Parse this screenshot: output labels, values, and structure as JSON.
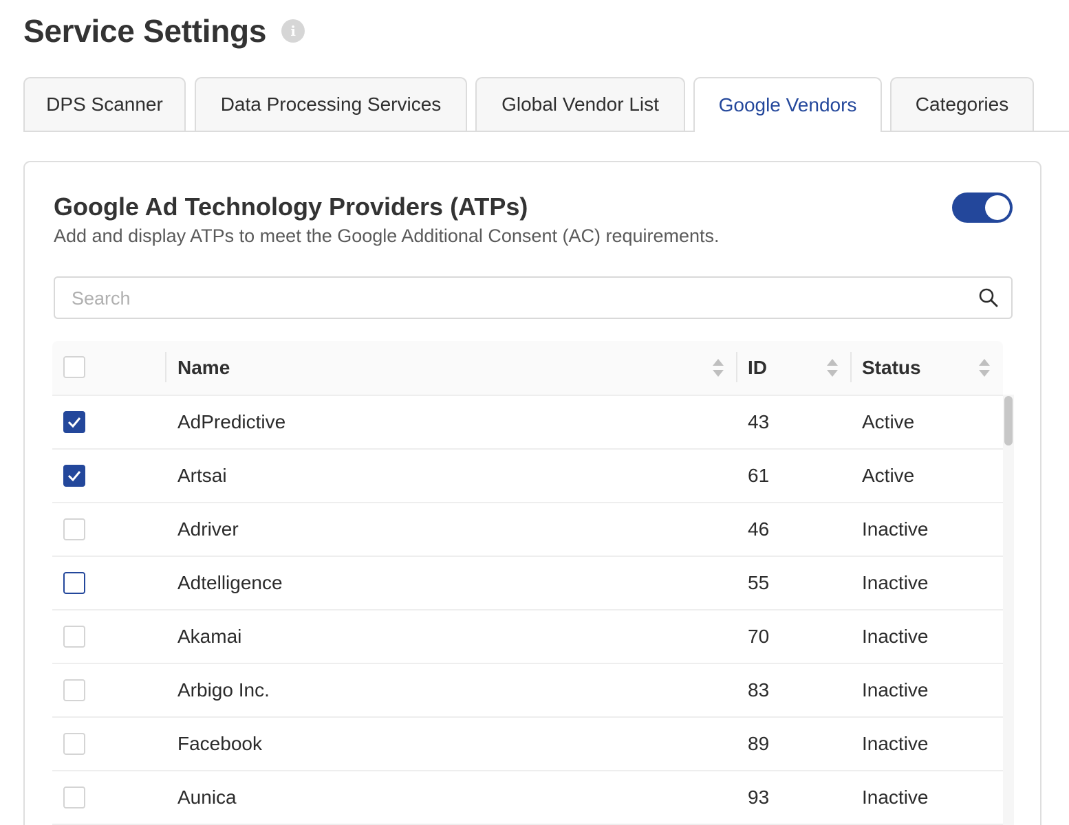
{
  "page": {
    "title": "Service Settings",
    "info_icon_glyph": "i"
  },
  "tabs": [
    {
      "label": "DPS Scanner",
      "active": false
    },
    {
      "label": "Data Processing Services",
      "active": false
    },
    {
      "label": "Global Vendor List",
      "active": false
    },
    {
      "label": "Google Vendors",
      "active": true
    },
    {
      "label": "Categories",
      "active": false
    }
  ],
  "section": {
    "title": "Google Ad Technology Providers (ATPs)",
    "description": "Add and display ATPs to meet the Google Additional Consent (AC) requirements.",
    "enabled": true
  },
  "search": {
    "placeholder": "Search",
    "value": ""
  },
  "table": {
    "columns": {
      "name": "Name",
      "id": "ID",
      "status": "Status"
    },
    "select_all_checked": false,
    "rows": [
      {
        "name": "AdPredictive",
        "id": "43",
        "status": "Active",
        "checked": true
      },
      {
        "name": "Artsai",
        "id": "61",
        "status": "Active",
        "checked": true
      },
      {
        "name": "Adriver",
        "id": "46",
        "status": "Inactive",
        "checked": false
      },
      {
        "name": "Adtelligence",
        "id": "55",
        "status": "Inactive",
        "checked": false
      },
      {
        "name": "Akamai",
        "id": "70",
        "status": "Inactive",
        "checked": false
      },
      {
        "name": "Arbigo Inc.",
        "id": "83",
        "status": "Inactive",
        "checked": false
      },
      {
        "name": "Facebook",
        "id": "89",
        "status": "Inactive",
        "checked": false
      },
      {
        "name": "Aunica",
        "id": "93",
        "status": "Inactive",
        "checked": false
      }
    ]
  },
  "colors": {
    "accent": "#23479b",
    "border": "#dcdcdc",
    "header_bg": "#fafafa"
  }
}
